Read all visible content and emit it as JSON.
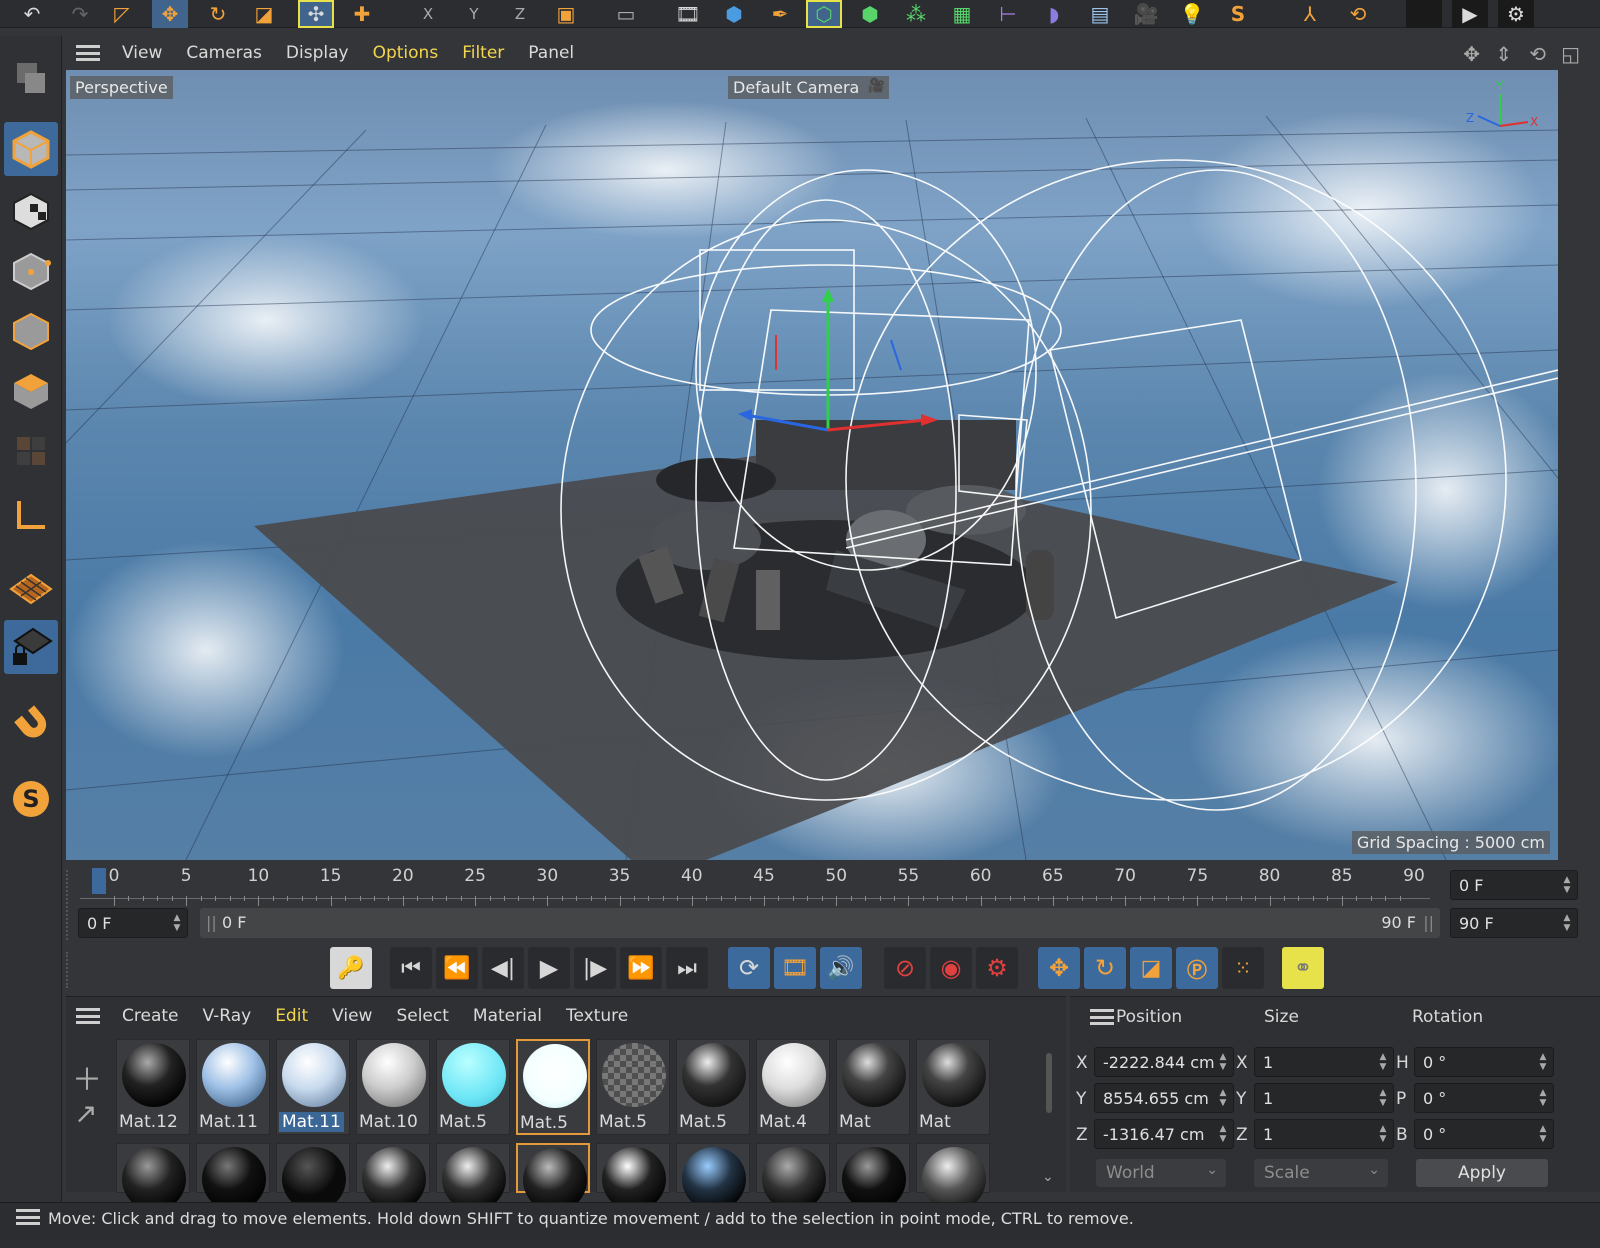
{
  "viewport_menu": {
    "items": [
      "View",
      "Cameras",
      "Display",
      "Options",
      "Filter",
      "Panel"
    ]
  },
  "viewport": {
    "view_name": "Perspective",
    "camera": "Default Camera",
    "grid_spacing": "Grid Spacing : 5000 cm",
    "axis": {
      "x": "X",
      "y": "Y",
      "z": "Z"
    }
  },
  "timeline": {
    "ticks": [
      "0",
      "5",
      "10",
      "15",
      "20",
      "25",
      "30",
      "35",
      "40",
      "45",
      "50",
      "55",
      "60",
      "65",
      "70",
      "75",
      "80",
      "85",
      "90"
    ],
    "current_frame": "0 F",
    "start_frame": "0 F",
    "range_start": "0 F",
    "range_end": "90 F",
    "end_frame": "90 F"
  },
  "material_menu": {
    "items": [
      "Create",
      "V-Ray",
      "Edit",
      "View",
      "Select",
      "Material",
      "Texture"
    ]
  },
  "materials": [
    {
      "name": "Mat.12"
    },
    {
      "name": "Mat.11"
    },
    {
      "name": "Mat.11"
    },
    {
      "name": "Mat.10"
    },
    {
      "name": "Mat.5"
    },
    {
      "name": "Mat.5"
    },
    {
      "name": "Mat.5"
    },
    {
      "name": "Mat.5"
    },
    {
      "name": "Mat.4"
    },
    {
      "name": "Mat"
    },
    {
      "name": "Mat"
    }
  ],
  "coordinates": {
    "headers": {
      "position": "Position",
      "size": "Size",
      "rotation": "Rotation"
    },
    "axes": {
      "x": "X",
      "y": "Y",
      "z": "Z",
      "h": "H",
      "p": "P",
      "b": "B"
    },
    "position": {
      "x": "-2222.844 cm",
      "y": "8554.655 cm",
      "z": "-1316.47 cm"
    },
    "size": {
      "x": "1",
      "y": "1",
      "z": "1"
    },
    "rotation": {
      "h": "0 °",
      "p": "0 °",
      "b": "0 °"
    },
    "space_dropdown": "World",
    "mode_dropdown": "Scale",
    "apply_label": "Apply"
  },
  "status": {
    "text": "Move: Click and drag to move elements. Hold down SHIFT to quantize movement / add to the selection in point mode, CTRL to remove."
  },
  "colors": {
    "accent": "#3d6a9a",
    "menu_highlight": "#f3d54e",
    "selection_border": "#e49a3a"
  }
}
